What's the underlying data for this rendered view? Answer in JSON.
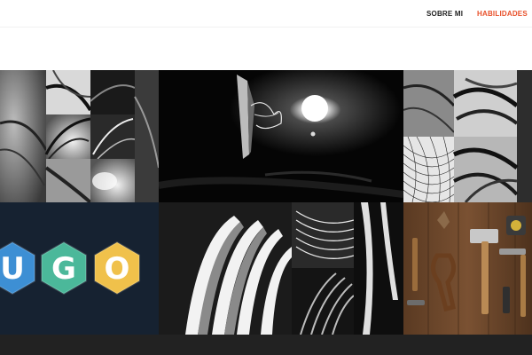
{
  "nav": {
    "items": [
      {
        "label": "SOBRE MI",
        "active": false
      },
      {
        "label": "HABILIDADES",
        "active": true
      }
    ],
    "active_color": "#e8502a"
  },
  "portfolio": {
    "tiles": [
      {
        "name": "bw-collage-curves",
        "style": "black-and-white"
      },
      {
        "name": "light-in-dark-sculpture",
        "style": "black-and-white"
      },
      {
        "name": "bw-collage-strands",
        "style": "black-and-white"
      },
      {
        "name": "hugo-logo",
        "letters": [
          "U",
          "G",
          "O"
        ],
        "colors": [
          "#3d8fd4",
          "#4bb89a",
          "#f0c14b"
        ]
      },
      {
        "name": "bw-strips-collage",
        "style": "black-and-white"
      },
      {
        "name": "tools-on-wood",
        "style": "color"
      }
    ]
  },
  "colors": {
    "logo_tile_bg": "#162231",
    "footer_bg": "#222222"
  }
}
